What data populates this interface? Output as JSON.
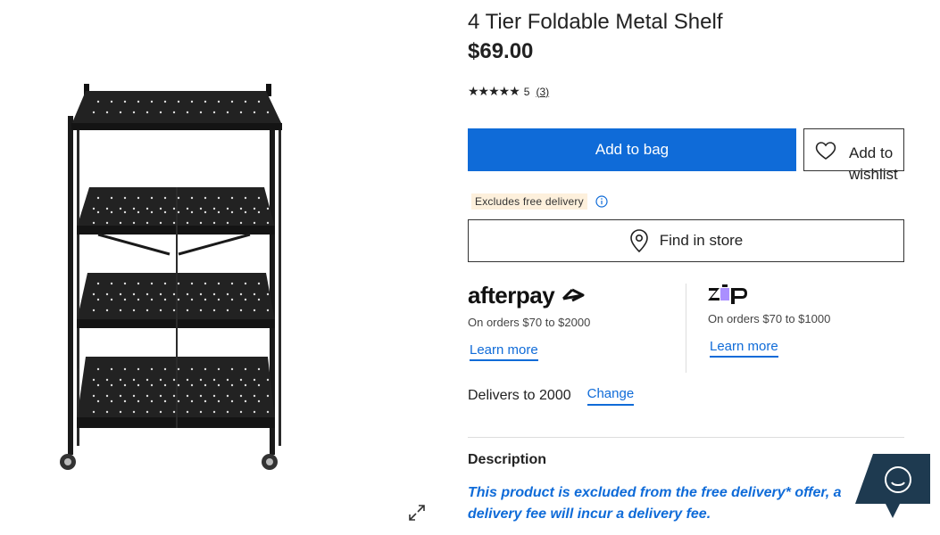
{
  "product": {
    "title": "4 Tier Foldable Metal Shelf",
    "price": "$69.00",
    "image_alt": "4 tier black foldable metal shelf on wheels"
  },
  "rating": {
    "stars": "★★★★★",
    "value": "5",
    "count": "(3)"
  },
  "actions": {
    "add_to_bag": "Add to bag",
    "wishlist": "Add to wishlist",
    "find_in_store": "Find in store"
  },
  "delivery_badge": {
    "text": "Excludes free delivery"
  },
  "afterpay": {
    "logo_text": "afterpay",
    "subtext": "On orders $70 to $2000",
    "learn_more": "Learn more"
  },
  "zip": {
    "logo_text": "zip",
    "subtext": "On orders $70 to $1000",
    "learn_more": "Learn more"
  },
  "delivers": {
    "text": "Delivers to 2000",
    "change": "Change"
  },
  "description": {
    "heading": "Description",
    "text": "This product is excluded from the free delivery* offer, a delivery fee will incur a delivery fee."
  },
  "colors": {
    "accent": "#0f6bd8",
    "badge_bg": "#fdf0dc",
    "chat_bg": "#1e3a50",
    "zip_purple": "#aa8fff"
  },
  "icons": {
    "expand": "expand-icon",
    "heart": "heart-icon",
    "info": "info-icon",
    "pin": "map-pin-icon",
    "chat": "chat-smiley-icon"
  }
}
